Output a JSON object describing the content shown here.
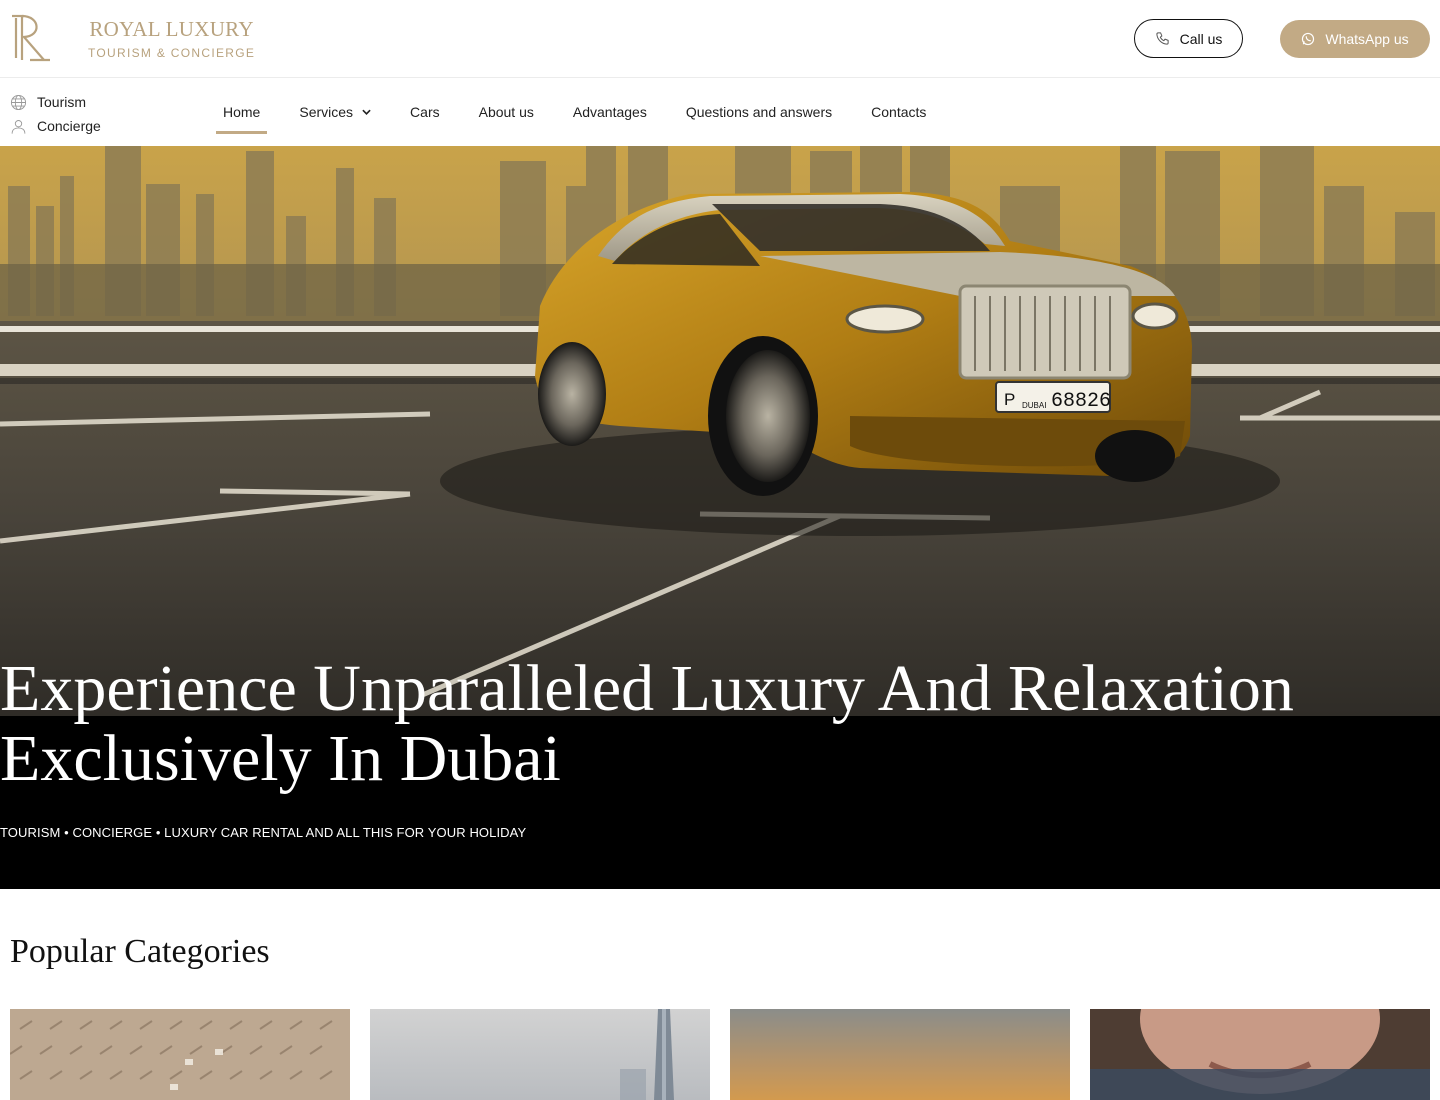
{
  "brand": {
    "title": "ROYAL LUXURY",
    "subtitle": "TOURISM & CONCIERGE",
    "color": "#b8a27e"
  },
  "header": {
    "call_label": "Call us",
    "whatsapp_label": "WhatsApp us",
    "whatsapp_color": "#c2aa85"
  },
  "side_links": [
    {
      "label": "Tourism",
      "icon": "globe-icon"
    },
    {
      "label": "Concierge",
      "icon": "user-icon"
    }
  ],
  "nav": {
    "items": [
      {
        "label": "Home",
        "active": true
      },
      {
        "label": "Services",
        "has_dropdown": true
      },
      {
        "label": "Cars"
      },
      {
        "label": "About us"
      },
      {
        "label": "Advantages"
      },
      {
        "label": "Questions and answers"
      },
      {
        "label": "Contacts"
      }
    ]
  },
  "hero": {
    "title_line1": "Experience Unparalleled Luxury And Relaxation",
    "title_line2": "Exclusively In Dubai",
    "subtitle": "TOURISM • CONCIERGE • LUXURY CAR RENTAL AND ALL THIS FOR YOUR HOLIDAY",
    "plate_letter": "P",
    "plate_city": "DUBAI",
    "plate_number": "68826"
  },
  "categories": {
    "heading": "Popular Categories"
  }
}
